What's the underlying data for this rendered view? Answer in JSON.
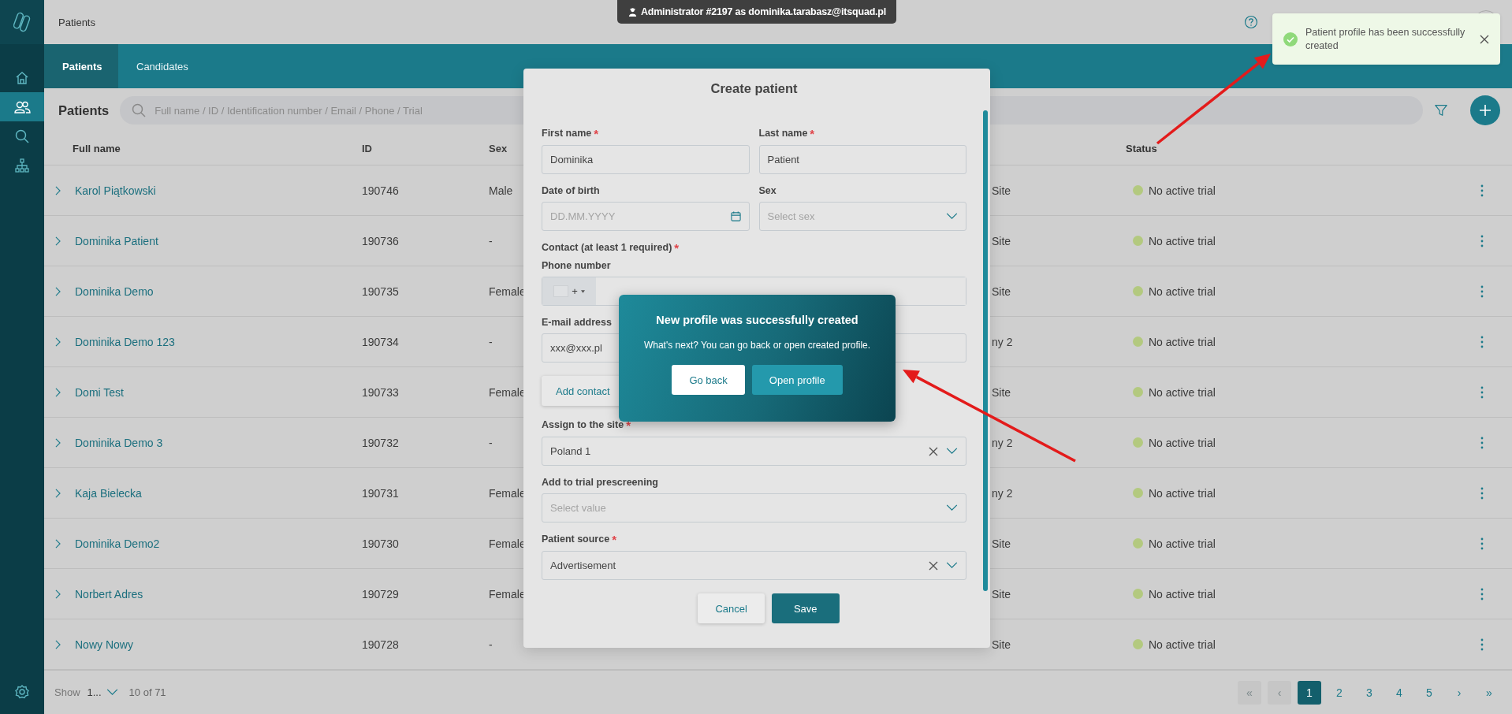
{
  "sidebar": {
    "items": [
      {
        "kind": "home",
        "selected": false
      },
      {
        "kind": "people",
        "selected": true
      },
      {
        "kind": "search",
        "selected": false
      },
      {
        "kind": "hierarchy",
        "selected": false
      }
    ],
    "bottom_items": [
      {
        "kind": "settings",
        "selected": false
      }
    ]
  },
  "header": {
    "breadcrumb": "Patients",
    "impersonation": "Administrator #2197 as dominika.tarabasz@itsquad.pl"
  },
  "tabs": [
    {
      "label": "Patients",
      "selected": true
    },
    {
      "label": "Candidates",
      "selected": false
    }
  ],
  "toolbar": {
    "title": "Patients",
    "search": {
      "placeholder": "Full name / ID / Identification number / Email / Phone / Trial"
    }
  },
  "table": {
    "columns": [
      "Full name",
      "ID",
      "Sex",
      "Status"
    ],
    "rows": [
      {
        "full_name": "Karol Piątkowski",
        "id": "190746",
        "sex": "Male",
        "column_4": "Site",
        "status": {
          "label": "No active trial",
          "color": "#b3c97f"
        }
      },
      {
        "full_name": "Dominika Patient",
        "id": "190736",
        "sex": "-",
        "column_4": "Site",
        "status": {
          "label": "No active trial",
          "color": "#b3c97f"
        }
      },
      {
        "full_name": "Dominika Demo",
        "id": "190735",
        "sex": "Female",
        "column_4": "Site",
        "status": {
          "label": "No active trial",
          "color": "#b3c97f"
        }
      },
      {
        "full_name": "Dominika Demo 123",
        "id": "190734",
        "sex": "-",
        "column_4": "ny 2",
        "status": {
          "label": "No active trial",
          "color": "#b3c97f"
        }
      },
      {
        "full_name": "Domi Test",
        "id": "190733",
        "sex": "Female",
        "column_4": "Site",
        "status": {
          "label": "No active trial",
          "color": "#b3c97f"
        }
      },
      {
        "full_name": "Dominika Demo 3",
        "id": "190732",
        "sex": "-",
        "column_4": "ny 2",
        "status": {
          "label": "No active trial",
          "color": "#b3c97f"
        }
      },
      {
        "full_name": "Kaja Bielecka",
        "id": "190731",
        "sex": "Female",
        "column_4": "ny 2",
        "status": {
          "label": "No active trial",
          "color": "#b3c97f"
        }
      },
      {
        "full_name": "Dominika Demo2",
        "id": "190730",
        "sex": "Female",
        "column_4": "Site",
        "status": {
          "label": "No active trial",
          "color": "#b3c97f"
        }
      },
      {
        "full_name": "Norbert Adres",
        "id": "190729",
        "sex": "Female",
        "column_4": "Site",
        "status": {
          "label": "No active trial",
          "color": "#b3c97f"
        }
      },
      {
        "full_name": "Nowy Nowy",
        "id": "190728",
        "sex": "-",
        "column_4": "Site",
        "status": {
          "label": "No active trial",
          "color": "#b3c97f"
        }
      }
    ]
  },
  "footer": {
    "show_label": "Show",
    "page_size": "1...",
    "range": "10 of 71",
    "pages": [
      {
        "label": "«",
        "disabled": true,
        "selected": false
      },
      {
        "label": "‹",
        "disabled": true,
        "selected": false
      },
      {
        "label": "1",
        "disabled": false,
        "selected": true
      },
      {
        "label": "2",
        "disabled": false,
        "selected": false
      },
      {
        "label": "3",
        "disabled": false,
        "selected": false
      },
      {
        "label": "4",
        "disabled": false,
        "selected": false
      },
      {
        "label": "5",
        "disabled": false,
        "selected": false
      },
      {
        "label": "›",
        "disabled": false,
        "selected": false
      },
      {
        "label": "»",
        "disabled": false,
        "selected": false
      }
    ]
  },
  "modal": {
    "title": "Create patient",
    "rows": [
      [
        {
          "kind": "text",
          "label": "First name",
          "required_mark": "*",
          "value": "Dominika"
        },
        {
          "kind": "text",
          "label": "Last name",
          "required_mark": "*",
          "value": "Patient"
        }
      ],
      [
        {
          "kind": "date",
          "label": "Date of birth",
          "placeholder": "DD.MM.YYYY"
        },
        {
          "kind": "select",
          "label": "Sex",
          "placeholder": "Select sex",
          "clearable": false
        }
      ],
      [
        {
          "kind": "heading",
          "label": "Contact (at least 1 required)",
          "required_mark": "*"
        }
      ],
      [
        {
          "kind": "phone",
          "label": "Phone number",
          "prefix": "+"
        }
      ],
      [
        {
          "kind": "text",
          "label": "E-mail address",
          "value": "xxx@xxx.pl"
        }
      ],
      [
        {
          "kind": "button",
          "label": "Add contact"
        }
      ],
      [
        {
          "kind": "select",
          "label": "Assign to the site",
          "required_mark": "*",
          "value": "Poland 1",
          "clearable": true
        }
      ],
      [
        {
          "kind": "select",
          "label": "Add to trial prescreening",
          "placeholder": "Select value",
          "clearable": false
        }
      ],
      [
        {
          "kind": "select",
          "label": "Patient source",
          "required_mark": "*",
          "value": "Advertisement",
          "clearable": true
        }
      ]
    ],
    "buttons": [
      {
        "label": "Cancel",
        "kind": "secondary"
      },
      {
        "label": "Save",
        "kind": "primary"
      }
    ]
  },
  "popup": {
    "title": "New profile was successfully created",
    "text": "What's next? You can go back or open created profile.",
    "buttons": [
      {
        "label": "Go back",
        "kind": "secondary"
      },
      {
        "label": "Open profile",
        "kind": "primary"
      }
    ]
  },
  "toast": {
    "kind": "success",
    "text": "Patient profile has been successfully created"
  },
  "annotations": [
    {
      "kind": "arrow"
    },
    {
      "kind": "arrow"
    }
  ]
}
